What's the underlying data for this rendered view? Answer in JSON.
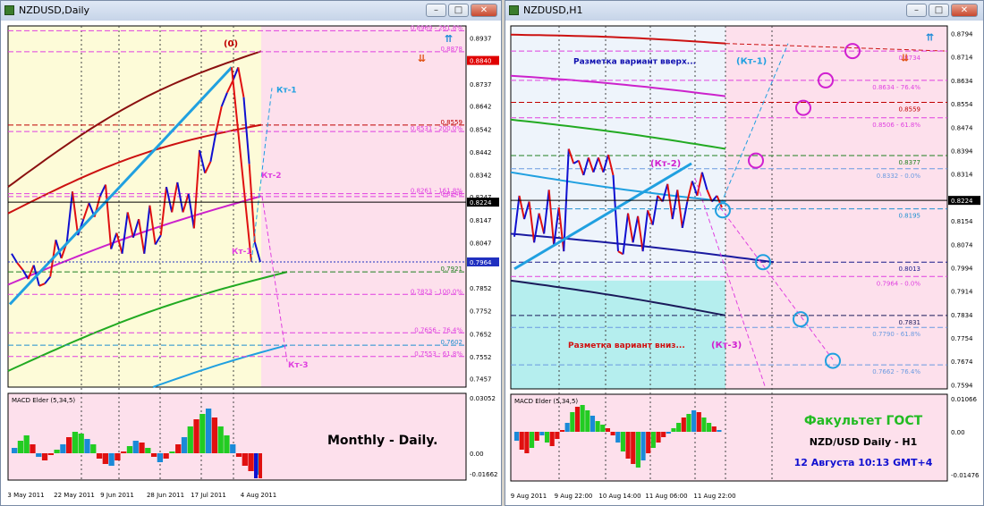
{
  "windows": [
    {
      "title": "NZDUSD,Daily",
      "price_labels": [
        {
          "v": 0.8937,
          "t": "0.8937"
        },
        {
          "v": 0.884,
          "t": "0.8840",
          "hl": "red"
        },
        {
          "v": 0.8737,
          "t": "0.8737"
        },
        {
          "v": 0.8642,
          "t": "0.8642"
        },
        {
          "v": 0.8542,
          "t": "0.8542"
        },
        {
          "v": 0.8442,
          "t": "0.8442"
        },
        {
          "v": 0.8342,
          "t": "0.8342"
        },
        {
          "v": 0.8247,
          "t": "0.8247"
        },
        {
          "v": 0.8224,
          "t": "0.8224",
          "hl": "black"
        },
        {
          "v": 0.8147,
          "t": "0.8147"
        },
        {
          "v": 0.8047,
          "t": "0.8047"
        },
        {
          "v": 0.7964,
          "t": "0.7964",
          "hl": "blue"
        },
        {
          "v": 0.7852,
          "t": "0.7852"
        },
        {
          "v": 0.7752,
          "t": "0.7752"
        },
        {
          "v": 0.7652,
          "t": "0.7652"
        },
        {
          "v": 0.7552,
          "t": "0.7552"
        },
        {
          "v": 0.7457,
          "t": "0.7457"
        }
      ],
      "levels": [
        {
          "v": 0.8969,
          "t": "0.8969 - 261.8%",
          "c": "#e040e0"
        },
        {
          "v": 0.8878,
          "t": "0.8878",
          "c": "#e040e0"
        },
        {
          "v": 0.8559,
          "t": "0.8559",
          "c": "#c00000"
        },
        {
          "v": 0.8531,
          "t": "0.8531 - 200.0%",
          "c": "#e040e0"
        },
        {
          "v": 0.8261,
          "t": "0.8261 - 161.8%",
          "c": "#e040e0"
        },
        {
          "v": 0.8248,
          "t": "0.8248",
          "c": "#e040e0"
        },
        {
          "v": 0.7921,
          "t": "0.7921",
          "c": "#208020"
        },
        {
          "v": 0.7823,
          "t": "0.7823 - 100.0%",
          "c": "#e040e0"
        },
        {
          "v": 0.7656,
          "t": "0.7656 - 76.4%",
          "c": "#e040e0"
        },
        {
          "v": 0.7602,
          "t": "0.7602",
          "c": "#2090d0"
        },
        {
          "v": 0.7553,
          "t": "0.7553 - 61.8%",
          "c": "#e040e0"
        }
      ],
      "labels": {
        "zero": "(0)",
        "kt1": "Кт-1",
        "kt1b": "Кт-1",
        "kt2": "Кт-2",
        "kt3": "Кт-3",
        "note": "Monthly - Daily."
      },
      "macd": {
        "title": "MACD Elder (5,34,5)",
        "top": "0.03052",
        "zero": "0.00",
        "bottom": "-0.01662"
      },
      "dates": [
        "3 May 2011",
        "22 May 2011",
        "9 Jun 2011",
        "28 Jun 2011",
        "17 Jul 2011",
        "4 Aug 2011"
      ]
    },
    {
      "title": "NZDUSD,H1",
      "price_labels": [
        {
          "v": 0.8794,
          "t": "0.8794"
        },
        {
          "v": 0.8714,
          "t": "0.8714"
        },
        {
          "v": 0.8634,
          "t": "0.8634"
        },
        {
          "v": 0.8554,
          "t": "0.8554"
        },
        {
          "v": 0.8474,
          "t": "0.8474"
        },
        {
          "v": 0.8394,
          "t": "0.8394"
        },
        {
          "v": 0.8314,
          "t": "0.8314"
        },
        {
          "v": 0.8224,
          "t": "0.8224",
          "hl": "black"
        },
        {
          "v": 0.8154,
          "t": "0.8154"
        },
        {
          "v": 0.8074,
          "t": "0.8074"
        },
        {
          "v": 0.7994,
          "t": "0.7994"
        },
        {
          "v": 0.7914,
          "t": "0.7914"
        },
        {
          "v": 0.7834,
          "t": "0.7834"
        },
        {
          "v": 0.7754,
          "t": "0.7754"
        },
        {
          "v": 0.7674,
          "t": "0.7674"
        },
        {
          "v": 0.7594,
          "t": "0.7594"
        }
      ],
      "levels": [
        {
          "v": 0.8734,
          "t": "0.8734",
          "c": "#e040e0"
        },
        {
          "v": 0.8634,
          "t": "0.8634 - 76.4%",
          "c": "#e040e0"
        },
        {
          "v": 0.8559,
          "t": "0.8559",
          "c": "#c00000"
        },
        {
          "v": 0.8506,
          "t": "0.8506 - 61.8%",
          "c": "#e040e0"
        },
        {
          "v": 0.8377,
          "t": "0.8377",
          "c": "#208020"
        },
        {
          "v": 0.8332,
          "t": "0.8332 - 0.0%",
          "c": "#6a9ae0"
        },
        {
          "v": 0.8195,
          "t": "0.8195",
          "c": "#2090d0"
        },
        {
          "v": 0.8013,
          "t": "0.8013",
          "c": "#1a1a8a"
        },
        {
          "v": 0.7964,
          "t": "0.7964 - 0.0%",
          "c": "#e040e0"
        },
        {
          "v": 0.7831,
          "t": "0.7831",
          "c": "#1a1a5a"
        },
        {
          "v": 0.779,
          "t": "0.7790 - 61.8%",
          "c": "#6a9ae0"
        },
        {
          "v": 0.7662,
          "t": "0.7662 - 76.4%",
          "c": "#6a9ae0"
        }
      ],
      "labels": {
        "up": "Разметка вариант вверх...",
        "kt1": "(Кт-1)",
        "kt2": "(Кт-2)",
        "down": "Разметка вариант вниз...",
        "kt3": "(Кт-3)",
        "fac": "Факультет ГОСТ",
        "pair": "NZD/USD Daily - H1",
        "date": "12 Августа 10:13 GMT+4"
      },
      "macd": {
        "title": "MACD Elder (5,34,5)",
        "top": "0.01066",
        "zero": "0.00",
        "bottom": "-0.01476"
      },
      "dates": [
        "9 Aug 2011",
        "9 Aug 22:00",
        "10 Aug 14:00",
        "11 Aug 06:00",
        "11 Aug 22:00"
      ]
    }
  ],
  "chart_data": [
    {
      "type": "line",
      "title": "NZDUSD,Daily",
      "xlabel": "",
      "ylabel": "",
      "ylim": [
        0.742,
        0.899
      ],
      "x": [
        "3 May 2011",
        "22 May 2011",
        "9 Jun 2011",
        "28 Jun 2011",
        "17 Jul 2011",
        "4 Aug 2011"
      ],
      "series": [
        {
          "values": [
            0.8,
            0.796,
            0.793,
            0.789,
            0.795,
            0.786,
            0.787,
            0.79,
            0.806,
            0.798,
            0.805,
            0.827,
            0.808,
            0.815,
            0.822,
            0.816,
            0.825,
            0.83,
            0.802,
            0.809,
            0.8,
            0.818,
            0.807,
            0.815,
            0.8,
            0.821,
            0.804,
            0.808,
            0.829,
            0.818,
            0.831,
            0.818,
            0.826,
            0.811,
            0.845,
            0.835,
            0.84,
            0.853,
            0.864,
            0.87,
            0.875,
            0.881,
            0.868,
            0.839,
            0.805,
            0.7964
          ]
        }
      ],
      "levels": [
        0.8969,
        0.8878,
        0.8559,
        0.8531,
        0.8261,
        0.8248,
        0.7921,
        0.7823,
        0.7656,
        0.7602,
        0.7553
      ],
      "macd": {
        "ylim": [
          -0.01662,
          0.03052
        ]
      }
    },
    {
      "type": "line",
      "title": "NZDUSD,H1",
      "xlabel": "",
      "ylabel": "",
      "ylim": [
        0.758,
        0.882
      ],
      "x": [
        "9 Aug 2011",
        "9 Aug 22:00",
        "10 Aug 14:00",
        "11 Aug 06:00",
        "11 Aug 22:00"
      ],
      "series": [
        {
          "values": [
            0.81,
            0.824,
            0.816,
            0.822,
            0.808,
            0.818,
            0.811,
            0.826,
            0.807,
            0.82,
            0.805,
            0.84,
            0.835,
            0.836,
            0.831,
            0.837,
            0.832,
            0.837,
            0.832,
            0.838,
            0.831,
            0.805,
            0.804,
            0.818,
            0.808,
            0.817,
            0.805,
            0.819,
            0.814,
            0.824,
            0.822,
            0.828,
            0.816,
            0.826,
            0.813,
            0.822,
            0.829,
            0.824,
            0.832,
            0.826,
            0.822,
            0.824,
            0.82
          ]
        }
      ],
      "levels": [
        0.8734,
        0.8634,
        0.8559,
        0.8506,
        0.8377,
        0.8332,
        0.8195,
        0.8013,
        0.7964,
        0.7831,
        0.779,
        0.7662
      ],
      "macd": {
        "ylim": [
          -0.01476,
          0.01066
        ]
      }
    }
  ]
}
